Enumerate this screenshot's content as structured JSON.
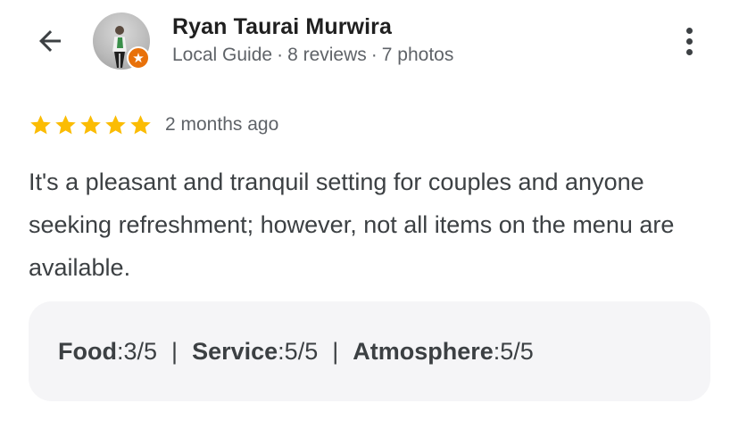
{
  "reviewer": {
    "name": "Ryan Taurai Murwira",
    "level": "Local Guide",
    "reviews": "8 reviews",
    "photos": "7 photos",
    "separator": "·"
  },
  "review": {
    "rating": 5,
    "max_rating": 5,
    "time_ago": "2 months ago",
    "text": "It's a pleasant and tranquil setting for couples and anyone seeking refreshment; however, not all items on the menu are available."
  },
  "aspect_ratings": [
    {
      "label": "Food",
      "value": "3/5"
    },
    {
      "label": "Service",
      "value": "5/5"
    },
    {
      "label": "Atmosphere",
      "value": "5/5"
    }
  ],
  "colors": {
    "star": "#fbbc04",
    "guide_badge": "#e8710a",
    "box_bg": "#f5f5f7"
  },
  "icons": {
    "back": "arrow-left-icon",
    "more": "more-vertical-icon",
    "star": "star-icon",
    "badge": "local-guide-badge-icon"
  }
}
